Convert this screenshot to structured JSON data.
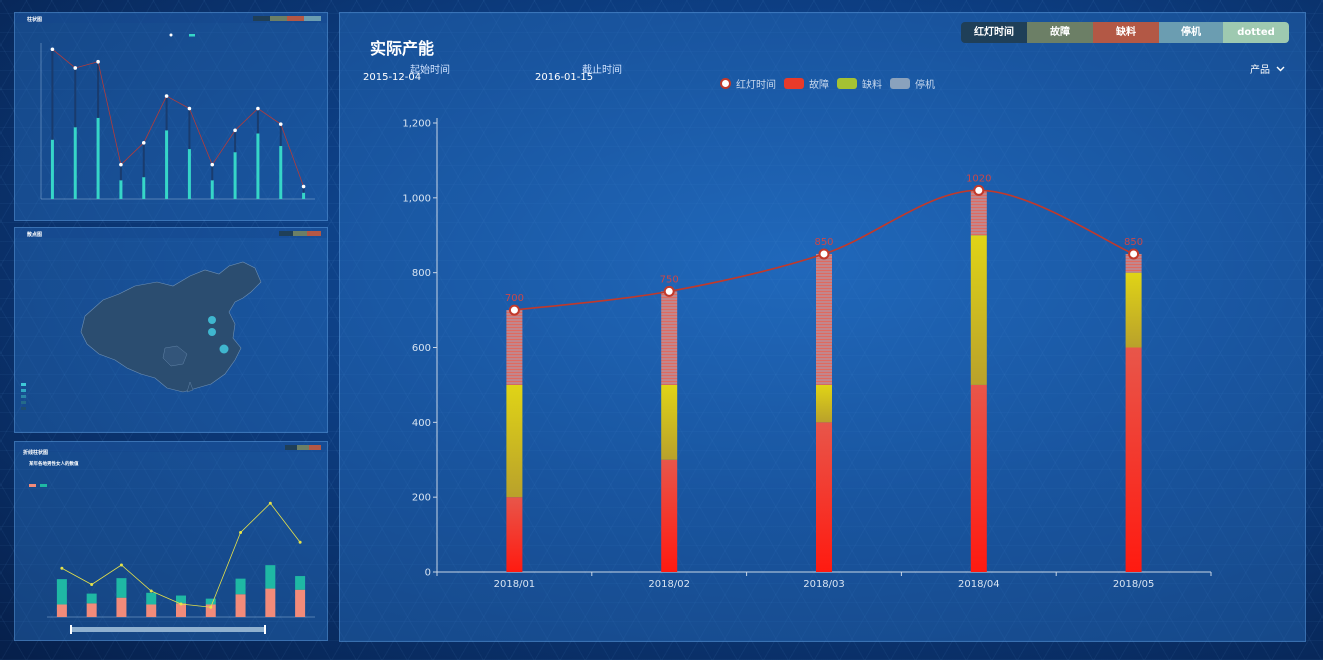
{
  "main": {
    "title": "实际产能",
    "start_label": "起始时间",
    "start_date": "2015-12-04",
    "end_label": "截止时间",
    "end_date": "2016-01-15",
    "dropdown_label": "产品",
    "buttons": [
      {
        "label": "红灯时间",
        "color": "#1f3f58"
      },
      {
        "label": "故障",
        "color": "#6c7f66"
      },
      {
        "label": "缺料",
        "color": "#b35845"
      },
      {
        "label": "停机",
        "color": "#6b9db1"
      },
      {
        "label": "dotted",
        "color": "#9ec9b0"
      }
    ],
    "legend": [
      {
        "label": "红灯时间",
        "kind": "circle"
      },
      {
        "label": "故障",
        "color": "#e83a2a"
      },
      {
        "label": "缺料",
        "color": "#a5c233"
      },
      {
        "label": "停机",
        "color": "#8aa2bd"
      }
    ]
  },
  "chart_data": {
    "type": "bar",
    "categories": [
      "2018/01",
      "2018/02",
      "2018/03",
      "2018/04",
      "2018/05"
    ],
    "series": [
      {
        "name": "故障",
        "values": [
          200,
          300,
          400,
          500,
          600
        ],
        "color": "#e83a2a"
      },
      {
        "name": "缺料",
        "values": [
          300,
          200,
          100,
          400,
          200
        ],
        "color": "#d6d21c"
      },
      {
        "name": "停机",
        "values": [
          200,
          250,
          350,
          120,
          50
        ],
        "color": "#c98a8f"
      }
    ],
    "line": {
      "name": "红灯时间",
      "values": [
        700,
        750,
        850,
        1020,
        850
      ],
      "labels": [
        "700",
        "750",
        "850",
        "1020",
        "850"
      ]
    },
    "ylim": [
      0,
      1200
    ],
    "yticks": [
      "0",
      "200",
      "400",
      "600",
      "800",
      "1,000",
      "1,200"
    ]
  },
  "panel_top": {
    "title": "柱状图",
    "buttons": [
      "",
      "",
      "",
      ""
    ],
    "bar_values": [
      3.8,
      4.6,
      5.2,
      1.2,
      1.4,
      4.4,
      3.2,
      1.2,
      3.0,
      4.2,
      3.4,
      0.4
    ],
    "line_values": [
      9.6,
      8.4,
      8.8,
      2.2,
      3.6,
      6.6,
      5.8,
      2.2,
      4.4,
      5.8,
      4.8,
      0.8
    ],
    "ymax": 10
  },
  "panel_mid": {
    "title": "散点图",
    "legend_rows": [
      "",
      "",
      "",
      "",
      ""
    ]
  },
  "panel_bottom": {
    "title": "折线柱状图",
    "subtitle": "某年各地男性女人的数值",
    "teal_values": [
      26,
      10,
      20,
      12,
      8,
      6,
      16,
      24,
      14
    ],
    "pink_values": [
      22,
      24,
      34,
      22,
      24,
      22,
      40,
      50,
      48
    ],
    "line_values": [
      30,
      20,
      32,
      16,
      8,
      6,
      52,
      70,
      46
    ]
  }
}
